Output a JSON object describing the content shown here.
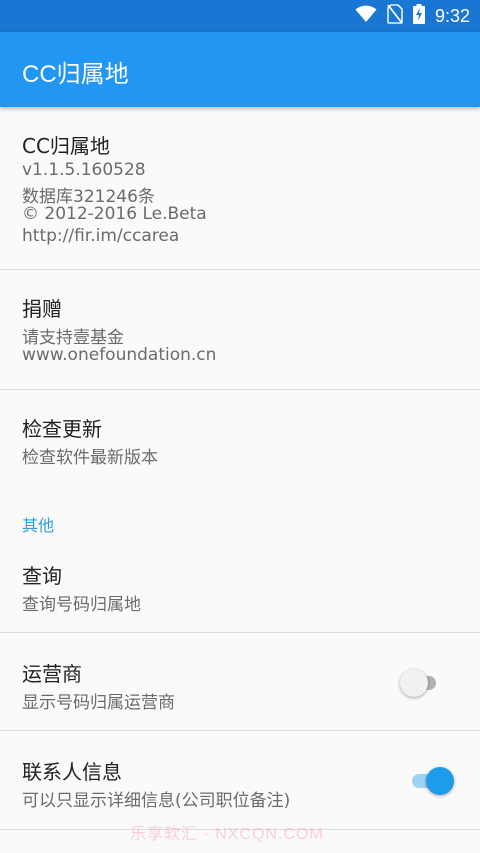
{
  "status_bar": {
    "time": "9:32",
    "icons": [
      "wifi-icon",
      "no-sim-icon",
      "battery-charging-icon"
    ]
  },
  "app_bar": {
    "title": "CC归属地"
  },
  "about": {
    "title": "CC归属地",
    "lines": [
      "v1.1.5.160528",
      "数据库321246条",
      "© 2012-2016 Le.Beta",
      "http://fir.im/ccarea"
    ]
  },
  "donate": {
    "title": "捐赠",
    "lines": [
      "请支持壹基金",
      "www.onefoundation.cn"
    ]
  },
  "update": {
    "title": "检查更新",
    "summary": "检查软件最新版本"
  },
  "category_other": {
    "label": "其他"
  },
  "query": {
    "title": "查询",
    "summary": "查询号码归属地"
  },
  "carrier": {
    "title": "运营商",
    "summary": "显示号码归属运营商",
    "enabled": false
  },
  "contact_info": {
    "title": "联系人信息",
    "summary": "可以只显示详细信息(公司职位备注)",
    "enabled": true
  },
  "watermark": "乐享软汇 · NXCQN.COM",
  "colors": {
    "status_bar": "#1976d2",
    "app_bar": "#2196f3",
    "accent": "#2aa1dc",
    "switch_on_thumb": "#1e9bea",
    "switch_on_track": "#9fd2f3",
    "switch_off_thumb": "#f1f1f1",
    "switch_off_track": "#b2b2b2"
  }
}
